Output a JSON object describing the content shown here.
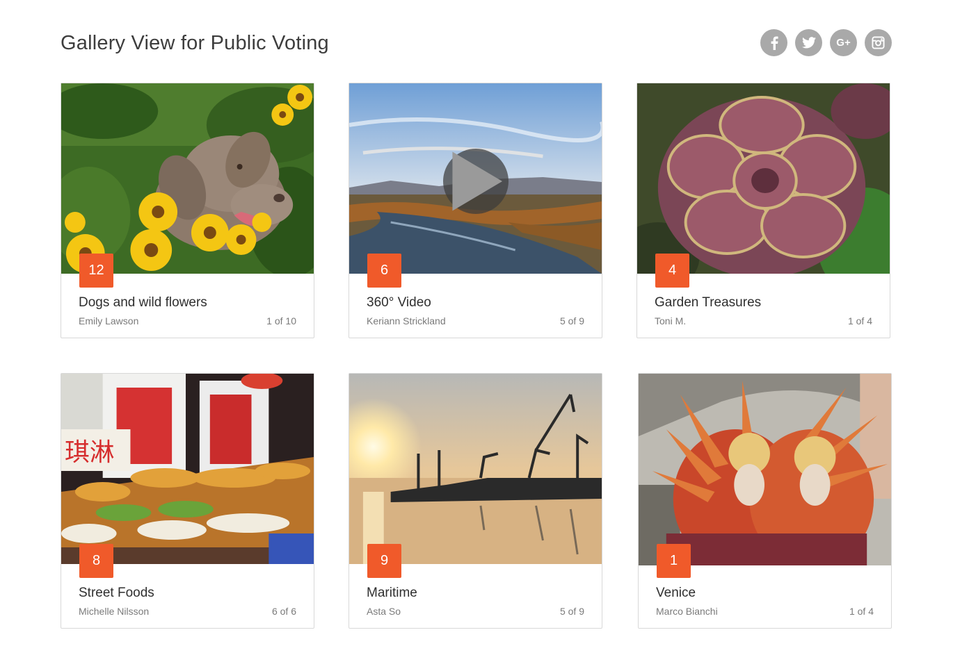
{
  "page": {
    "title": "Gallery View for Public Voting"
  },
  "social": [
    {
      "name": "facebook"
    },
    {
      "name": "twitter"
    },
    {
      "name": "google-plus",
      "label": "G+"
    },
    {
      "name": "instagram"
    }
  ],
  "colors": {
    "badge": "#f05a2a",
    "social": "#a9a9a9"
  },
  "galleries": [
    {
      "votes": "12",
      "title": "Dogs and wild flowers",
      "author": "Emily Lawson",
      "count": "1 of 10"
    },
    {
      "votes": "6",
      "title": "360° Video",
      "author": "Keriann Strickland",
      "count": "5 of 9"
    },
    {
      "votes": "4",
      "title": "Garden Treasures",
      "author": "Toni M.",
      "count": "1 of 4"
    },
    {
      "votes": "8",
      "title": "Street Foods",
      "author": "Michelle Nilsson",
      "count": "6 of 6"
    },
    {
      "votes": "9",
      "title": "Maritime",
      "author": "Asta So",
      "count": "5 of 9"
    },
    {
      "votes": "1",
      "title": "Venice",
      "author": "Marco Bianchi",
      "count": "1 of 4"
    }
  ]
}
